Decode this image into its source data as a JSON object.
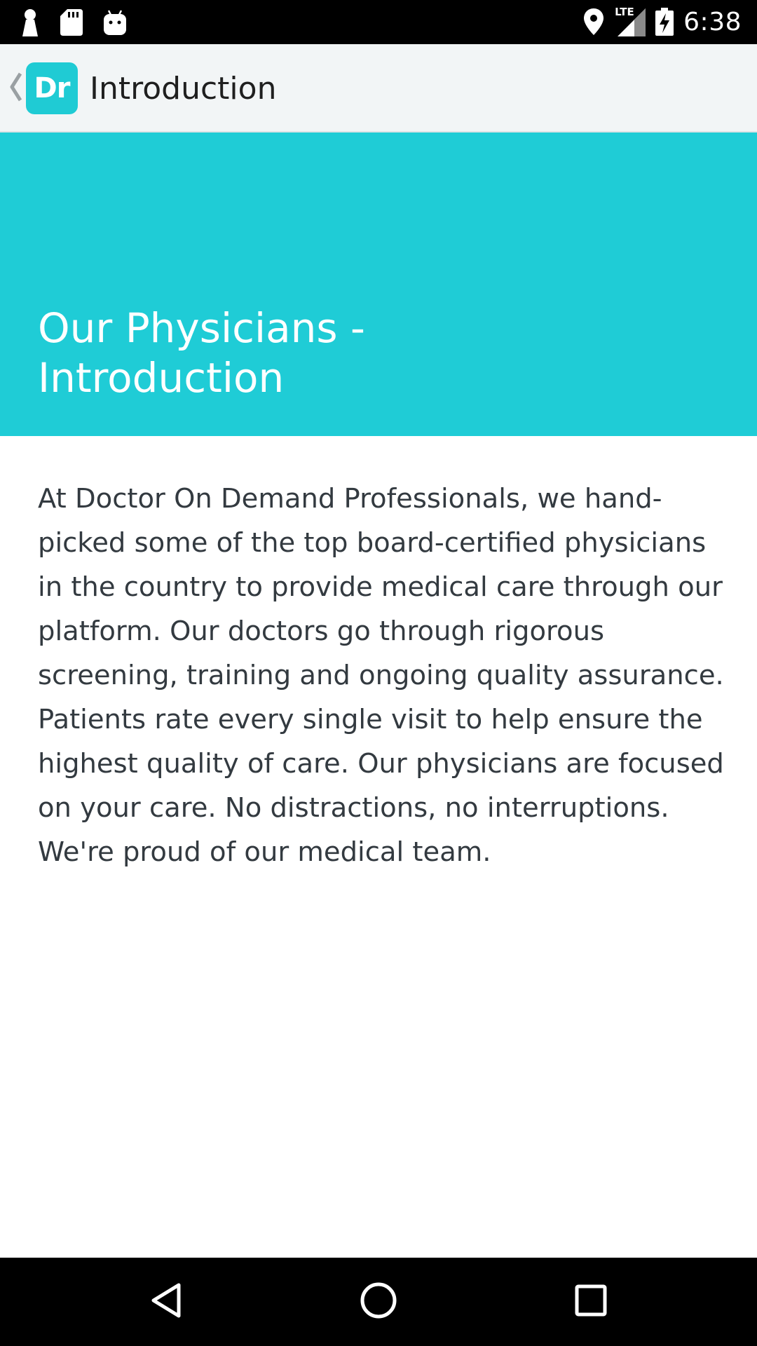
{
  "status_bar": {
    "time": "6:38",
    "network": "LTE",
    "icons": [
      "keyhole-icon",
      "sd-card-icon",
      "android-icon",
      "location-icon",
      "signal-icon",
      "battery-charging-icon"
    ]
  },
  "app_bar": {
    "logo_text": "Dr",
    "title": "Introduction",
    "back_icon": "chevron-left-icon"
  },
  "hero": {
    "title": "Our Physicians - Introduction"
  },
  "body": {
    "text": "At Doctor On Demand Professionals, we hand-picked some of the top board-certified physicians in the country to provide medical care through our platform. Our doctors go through rigorous screening, training and ongoing quality assurance. Patients rate every single visit to help ensure the highest quality of care. Our physicians are focused on your care. No distractions, no interruptions. We're proud of our medical team."
  },
  "nav_bar": {
    "buttons": [
      "back-triangle-icon",
      "home-circle-icon",
      "recents-square-icon"
    ]
  },
  "colors": {
    "accent": "#1fccd6",
    "app_bar_bg": "#f2f5f6",
    "body_text": "#333a40"
  }
}
